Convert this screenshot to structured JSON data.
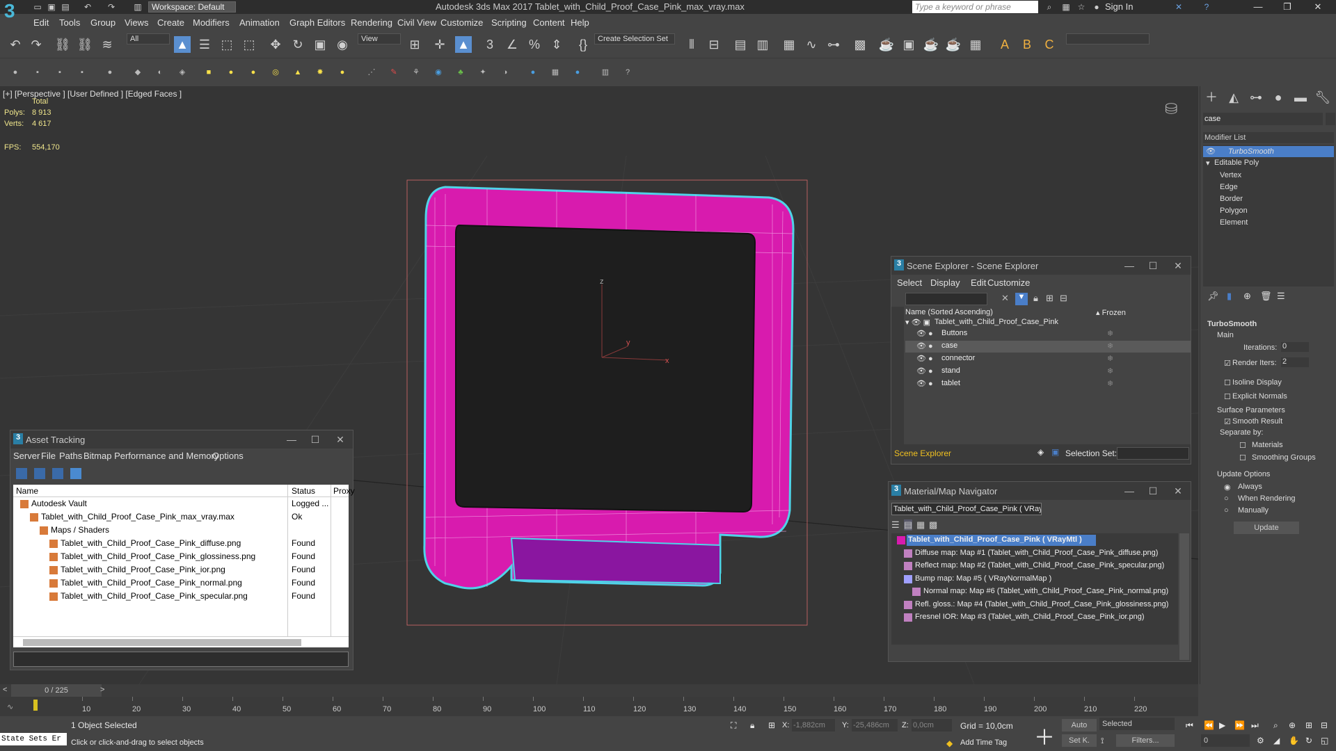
{
  "app": {
    "title": "Autodesk 3ds Max 2017     Tablet_with_Child_Proof_Case_Pink_max_vray.max",
    "workspace_label": "Workspace: Default",
    "search_placeholder": "Type a keyword or phrase",
    "sign_in": "Sign In"
  },
  "menu": [
    "Edit",
    "Tools",
    "Group",
    "Views",
    "Create",
    "Modifiers",
    "Animation",
    "Graph Editors",
    "Rendering",
    "Civil View",
    "Customize",
    "Scripting",
    "Content",
    "Help"
  ],
  "toolbar": {
    "filter_all": "All",
    "ref_coord": "View",
    "create_selection_set": "Create Selection Set"
  },
  "viewport": {
    "label": "[+] [Perspective ]  [User Defined ]  [Edged Faces ]",
    "total_label": "Total",
    "polys_label": "Polys:",
    "polys_value": "8 913",
    "verts_label": "Verts:",
    "verts_value": "4 617",
    "fps_label": "FPS:",
    "fps_value": "554,170",
    "axis_z": "z",
    "axis_y": "y",
    "axis_x": "x"
  },
  "command_panel": {
    "name_field": "case",
    "modifier_list": "Modifier List",
    "stack": [
      "TurboSmooth",
      "Editable Poly",
      "Vertex",
      "Edge",
      "Border",
      "Polygon",
      "Element"
    ],
    "turbosmooth_title": "TurboSmooth",
    "main": "Main",
    "iterations_label": "Iterations:",
    "iterations_value": "0",
    "render_iters_label": "Render Iters:",
    "render_iters_value": "2",
    "isoline": "Isoline Display",
    "explicit_normals": "Explicit Normals",
    "surface_params": "Surface Parameters",
    "smooth_result": "Smooth Result",
    "separate_by": "Separate by:",
    "materials": "Materials",
    "smoothing_groups": "Smoothing Groups",
    "update_options": "Update Options",
    "always": "Always",
    "when_rendering": "When Rendering",
    "manually": "Manually",
    "update_button": "Update"
  },
  "scene_explorer": {
    "title": "Scene Explorer - Scene Explorer",
    "menu": [
      "Select",
      "Display",
      "Edit",
      "Customize"
    ],
    "col_name": "Name (Sorted Ascending)",
    "col_frozen": "▴ Frozen",
    "root": "Tablet_with_Child_Proof_Case_Pink",
    "items": [
      "Buttons",
      "case",
      "connector",
      "stand",
      "tablet"
    ],
    "footer_label": "Scene Explorer",
    "selection_set_label": "Selection Set:"
  },
  "asset_tracking": {
    "title": "Asset Tracking",
    "menu": [
      "Server",
      "File",
      "Paths",
      "Bitmap Performance and Memory",
      "Options"
    ],
    "col_name": "Name",
    "col_status": "Status",
    "col_proxy": "Proxy",
    "rows": [
      {
        "name": "Autodesk Vault",
        "status": "Logged ..."
      },
      {
        "name": "Tablet_with_Child_Proof_Case_Pink_max_vray.max",
        "status": "Ok"
      },
      {
        "name": "Maps / Shaders",
        "status": ""
      },
      {
        "name": "Tablet_with_Child_Proof_Case_Pink_diffuse.png",
        "status": "Found"
      },
      {
        "name": "Tablet_with_Child_Proof_Case_Pink_glossiness.png",
        "status": "Found"
      },
      {
        "name": "Tablet_with_Child_Proof_Case_Pink_ior.png",
        "status": "Found"
      },
      {
        "name": "Tablet_with_Child_Proof_Case_Pink_normal.png",
        "status": "Found"
      },
      {
        "name": "Tablet_with_Child_Proof_Case_Pink_specular.png",
        "status": "Found"
      }
    ]
  },
  "material_navigator": {
    "title": "Material/Map Navigator",
    "field": "Tablet_with_Child_Proof_Case_Pink  ( VRayMt",
    "items": [
      "Tablet_with_Child_Proof_Case_Pink  ( VRayMtl )",
      "Diffuse map: Map #1 (Tablet_with_Child_Proof_Case_Pink_diffuse.png)",
      "Reflect map: Map #2 (Tablet_with_Child_Proof_Case_Pink_specular.png)",
      "Bump map: Map #5  ( VRayNormalMap )",
      "Normal map: Map #6 (Tablet_with_Child_Proof_Case_Pink_normal.png)",
      "Refl. gloss.: Map #4 (Tablet_with_Child_Proof_Case_Pink_glossiness.png)",
      "Fresnel IOR: Map #3 (Tablet_with_Child_Proof_Case_Pink_ior.png)"
    ]
  },
  "timeline": {
    "frame": "0 / 225",
    "ticks": [
      "10",
      "20",
      "30",
      "40",
      "50",
      "60",
      "70",
      "80",
      "90",
      "100",
      "110",
      "120",
      "130",
      "140",
      "150",
      "160",
      "170",
      "180",
      "190",
      "200",
      "210",
      "220"
    ]
  },
  "status": {
    "maxscript": "State Sets Er",
    "selected": "1 Object Selected",
    "prompt": "Click or click-and-drag to select objects",
    "x_label": "X:",
    "x_value": "-1,882cm",
    "y_label": "Y:",
    "y_value": "-25,486cm",
    "z_label": "Z:",
    "z_value": "0,0cm",
    "grid": "Grid = 10,0cm",
    "add_time_tag": "Add Time Tag",
    "auto": "Auto",
    "selected_dd": "Selected",
    "setk": "Set K.",
    "filters": "Filters...",
    "frame_value": "0"
  },
  "colors": {
    "case": "#d81bae",
    "selection": "#4fd3e8",
    "highlight": "#4a7ec8"
  }
}
